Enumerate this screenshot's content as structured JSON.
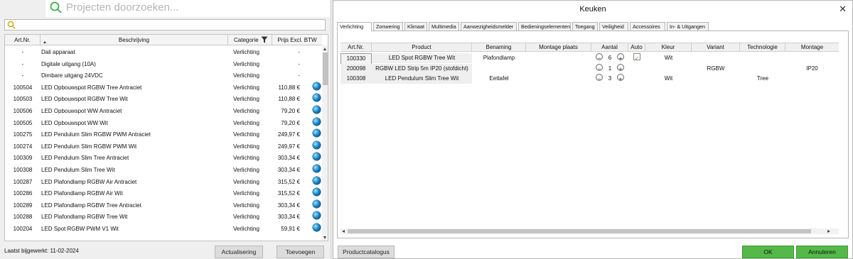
{
  "search": {
    "placeholder": "Projecten doorzoeken..."
  },
  "left_table": {
    "headers": {
      "art": "Art.Nr.",
      "desc": "Beschrijving",
      "cat": "Categorie",
      "price": "Prijs Excl. BTW"
    },
    "rows": [
      {
        "art": "-",
        "desc": "Dali apparaat",
        "cat": "Verlichting",
        "price": "-",
        "globe": false
      },
      {
        "art": "-",
        "desc": "Digitale uitgang (10A)",
        "cat": "Verlichting",
        "price": "-",
        "globe": false
      },
      {
        "art": "-",
        "desc": "Dimbare uitgang 24VDC",
        "cat": "Verlichting",
        "price": "-",
        "globe": false
      },
      {
        "art": "100504",
        "desc": "LED Opbouwspot RGBW Tree Antraciet",
        "cat": "Verlichting",
        "price": "110,88 €",
        "globe": true
      },
      {
        "art": "100503",
        "desc": "LED Opbouwspot RGBW Tree Wit",
        "cat": "Verlichting",
        "price": "110,88 €",
        "globe": true
      },
      {
        "art": "100506",
        "desc": "LED Opbouwspot WW Antraciet",
        "cat": "Verlichting",
        "price": "79,20 €",
        "globe": true
      },
      {
        "art": "100505",
        "desc": "LED Opbouwspot WW Wit",
        "cat": "Verlichting",
        "price": "79,20 €",
        "globe": true
      },
      {
        "art": "100275",
        "desc": "LED Pendulum Slim RGBW PWM Antraciet",
        "cat": "Verlichting",
        "price": "249,97 €",
        "globe": true
      },
      {
        "art": "100274",
        "desc": "LED Pendulum Slim RGBW PWM Wit",
        "cat": "Verlichting",
        "price": "249,97 €",
        "globe": true
      },
      {
        "art": "100309",
        "desc": "LED Pendulum Slim Tree Antraciet",
        "cat": "Verlichting",
        "price": "303,34 €",
        "globe": true
      },
      {
        "art": "100308",
        "desc": "LED Pendulum Slim Tree Wit",
        "cat": "Verlichting",
        "price": "303,34 €",
        "globe": true
      },
      {
        "art": "100287",
        "desc": "LED Plafondlamp RGBW Air Antraciet",
        "cat": "Verlichting",
        "price": "315,52 €",
        "globe": true
      },
      {
        "art": "100286",
        "desc": "LED Plafondlamp RGBW Air Wit",
        "cat": "Verlichting",
        "price": "315,52 €",
        "globe": true
      },
      {
        "art": "100289",
        "desc": "LED Plafondlamp RGBW Tree Antraciet",
        "cat": "Verlichting",
        "price": "303,34 €",
        "globe": true
      },
      {
        "art": "100288",
        "desc": "LED Plafondlamp RGBW Tree Wit",
        "cat": "Verlichting",
        "price": "303,34 €",
        "globe": true
      },
      {
        "art": "100204",
        "desc": "LED Spot RGBW PWM V1 Wit",
        "cat": "Verlichting",
        "price": "59,91 €",
        "globe": true
      }
    ]
  },
  "footer_left": {
    "last_updated": "Laatst bijgewerkt: 11-02-2024",
    "update_button": "Actualisering",
    "add_button": "Toevoegen"
  },
  "dialog": {
    "title": "Keuken",
    "close": "✕",
    "tabs": [
      "Verlichting",
      "Zonwering",
      "Klimaat",
      "Multimedia",
      "Aanwezigheidsmelder",
      "Bedieningselementen",
      "Toegang",
      "Veiligheid",
      "Accessoires",
      "In- & Uitgangen"
    ],
    "headers": [
      "Art.Nr.",
      "Product",
      "Benaming",
      "Montage plaats",
      "Aantal",
      "Auto",
      "Kleur",
      "Variant",
      "Technologie",
      "Montage"
    ],
    "rows": [
      {
        "art": "100330",
        "product": "LED Spot RGBW Tree Wit",
        "benaming": "Plafondlamp",
        "montage_plaats": "",
        "aantal": "6",
        "auto": true,
        "kleur": "Wit",
        "variant": "",
        "technologie": "",
        "montage": ""
      },
      {
        "art": "200098",
        "product": "RGBW LED Strip 5m IP20 (stofdicht)",
        "benaming": "",
        "montage_plaats": "",
        "aantal": "1",
        "auto": false,
        "kleur": "",
        "variant": "RGBW",
        "technologie": "",
        "montage": "IP20"
      },
      {
        "art": "100308",
        "product": "LED Pendulum Slim Tree Wit",
        "benaming": "Eettafel",
        "montage_plaats": "",
        "aantal": "3",
        "auto": false,
        "kleur": "Wit",
        "variant": "",
        "technologie": "Tree",
        "montage": ""
      }
    ],
    "buttons": {
      "catalog": "Productcatalogus",
      "ok": "OK",
      "cancel": "Annuleren"
    }
  },
  "colors": {
    "accent_green": "#54b948",
    "search_green": "#3fae49"
  }
}
